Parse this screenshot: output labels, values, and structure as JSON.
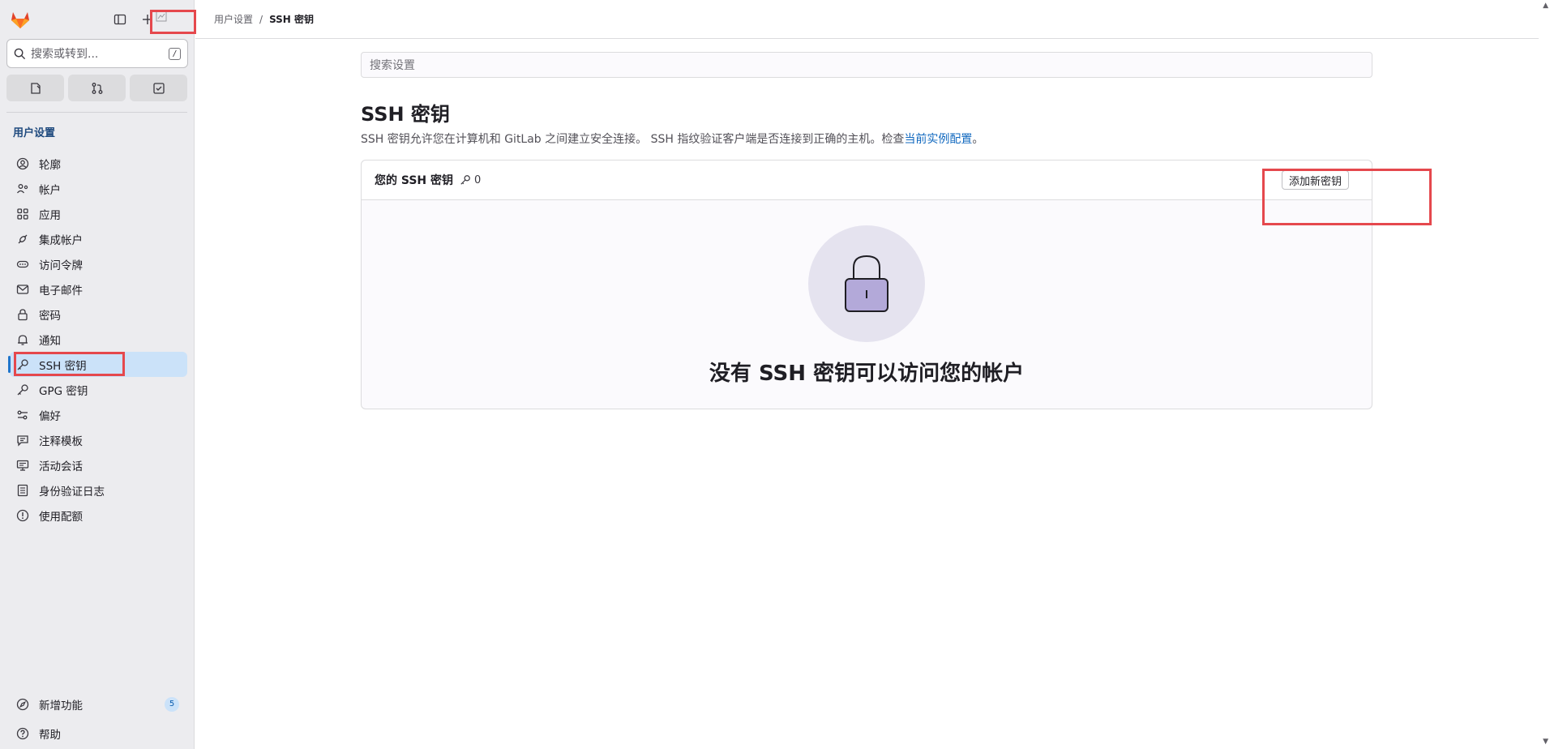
{
  "sidebar": {
    "avatar_alt": "",
    "search_placeholder": "搜索或转到...",
    "search_shortcut": "/",
    "section_title": "用户设置",
    "items": [
      {
        "label": "轮廓",
        "icon": "profile-icon"
      },
      {
        "label": "帐户",
        "icon": "account-icon"
      },
      {
        "label": "应用",
        "icon": "applications-icon"
      },
      {
        "label": "集成帐户",
        "icon": "chat-integration-icon"
      },
      {
        "label": "访问令牌",
        "icon": "token-icon"
      },
      {
        "label": "电子邮件",
        "icon": "mail-icon"
      },
      {
        "label": "密码",
        "icon": "lock-icon"
      },
      {
        "label": "通知",
        "icon": "bell-icon"
      },
      {
        "label": "SSH 密钥",
        "icon": "key-icon",
        "active": true
      },
      {
        "label": "GPG 密钥",
        "icon": "key-icon"
      },
      {
        "label": "偏好",
        "icon": "preferences-icon"
      },
      {
        "label": "注释模板",
        "icon": "comment-template-icon"
      },
      {
        "label": "活动会话",
        "icon": "monitor-icon"
      },
      {
        "label": "身份验证日志",
        "icon": "log-icon"
      },
      {
        "label": "使用配额",
        "icon": "usage-quota-icon"
      }
    ],
    "whats_new_label": "新增功能",
    "whats_new_count": "5",
    "help_label": "帮助"
  },
  "breadcrumb": {
    "parent": "用户设置",
    "separator": "/",
    "current": "SSH 密钥"
  },
  "main": {
    "search_placeholder": "搜索设置",
    "title": "SSH 密钥",
    "description": "SSH 密钥允许您在计算机和 GitLab 之间建立安全连接。 SSH 指纹验证客户端是否连接到正确的主机。检查",
    "description_link": "当前实例配置",
    "description_end": "。",
    "card_title": "您的 SSH 密钥",
    "key_count": "0",
    "add_button": "添加新密钥",
    "empty_text": "没有 SSH 密钥可以访问您的帐户"
  },
  "colors": {
    "accent": "#1f75cb",
    "highlight": "#e5484d",
    "empty_circle": "#e5e3ef",
    "lock_body": "#b3a9d9"
  }
}
